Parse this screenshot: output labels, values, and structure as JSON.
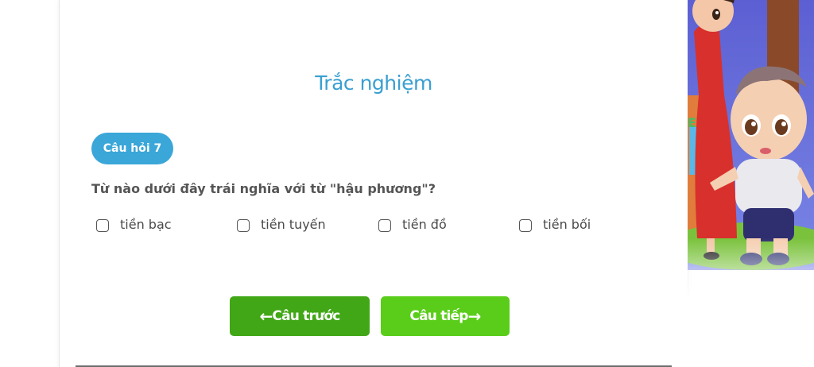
{
  "quiz": {
    "title": "Trắc nghiệm",
    "question_badge": "Câu hỏi 7",
    "question_text": "Từ nào dưới đây trái nghĩa với từ \"hậu phương\"?",
    "options": [
      {
        "label": "tiền bạc",
        "checked": false
      },
      {
        "label": "tiền tuyến",
        "checked": false
      },
      {
        "label": "tiền đồ",
        "checked": false
      },
      {
        "label": "tiền bối",
        "checked": false
      }
    ]
  },
  "navigation": {
    "prev_label": "Câu trước",
    "next_label": "Câu tiếp",
    "prev_icon": "arrow-left-icon",
    "next_icon": "arrow-right-icon"
  },
  "colors": {
    "accent_blue": "#3ba6d8",
    "button_green_dark": "#41a716",
    "button_green_light": "#5acd1a",
    "text_gray": "#555555"
  }
}
